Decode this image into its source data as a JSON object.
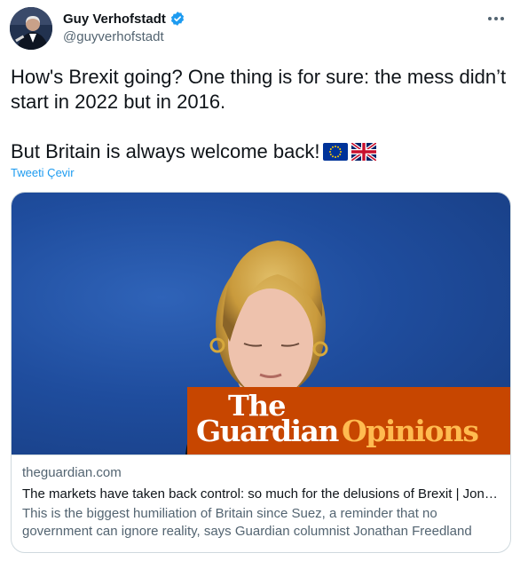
{
  "author": {
    "name": "Guy Verhofstadt",
    "handle": "@guyverhofstadt",
    "verified": true,
    "avatar_icon": "profile-photo",
    "verified_icon": "verified-badge-icon"
  },
  "tweet": {
    "line1": "How's Brexit going? One thing is for sure: the mess didn’t start in 2022 but in 2016.",
    "line2": "But Britain is always welcome back!",
    "emoji": [
      "eu-flag-icon",
      "uk-flag-icon"
    ],
    "translate_label": "Tweeti Çevir"
  },
  "card": {
    "image_brand_the": "The",
    "image_brand_guardian": "Guardian",
    "image_brand_opinions": "Opinions",
    "domain": "theguardian.com",
    "title": "The markets have taken back control: so much for the delusions of Brexit | Jonathan Freedland",
    "description": "This is the biggest humiliation of Britain since Suez, a reminder that no government can ignore reality, says Guardian columnist Jonathan Freedland"
  },
  "colors": {
    "link_blue": "#1d9bf0",
    "text_primary": "#0f1419",
    "text_secondary": "#536471",
    "border": "#cfd9de",
    "guardian_orange": "#c74600",
    "opinions_yellow": "#ffbb50"
  }
}
